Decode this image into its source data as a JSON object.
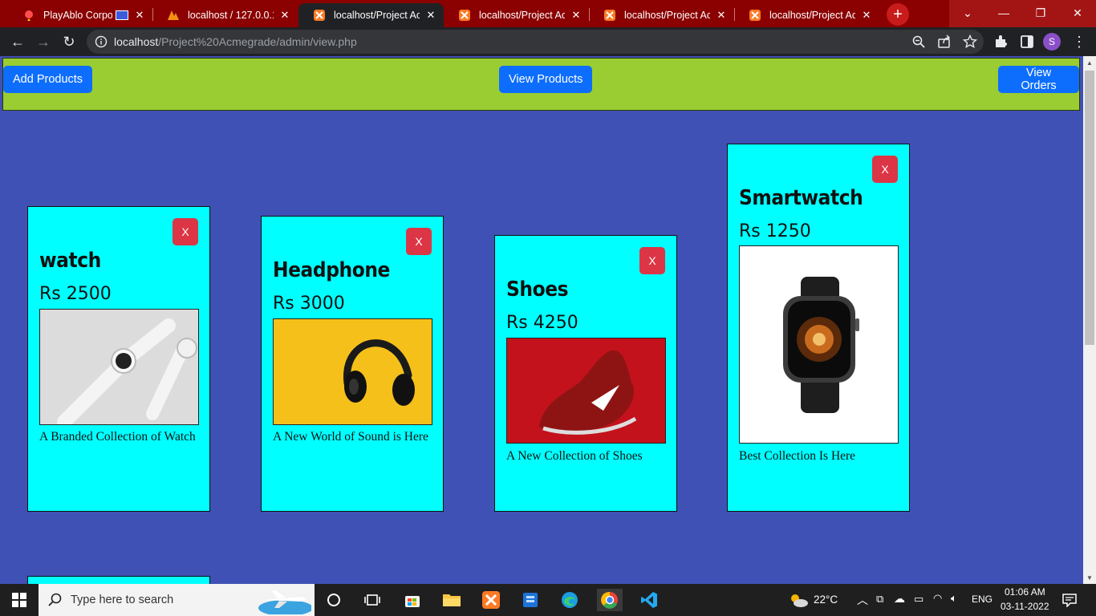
{
  "browser": {
    "tabs": [
      {
        "title": "PlayAblo Corporat",
        "icon": "playablo-icon"
      },
      {
        "title": "localhost / 127.0.0.1 /",
        "icon": "phpmyadmin-icon"
      },
      {
        "title": "localhost/Project Acm",
        "icon": "xampp-icon"
      },
      {
        "title": "localhost/Project Acm",
        "icon": "xampp-icon"
      },
      {
        "title": "localhost/Project Acm",
        "icon": "xampp-icon"
      },
      {
        "title": "localhost/Project Acm",
        "icon": "xampp-icon"
      }
    ],
    "url_host": "localhost",
    "url_path": "/Project%20Acmegrade/admin/view.php",
    "profile_initial": "S"
  },
  "nav": {
    "add_products": "Add Products",
    "view_products": "View Products",
    "view_orders": "View Orders"
  },
  "products": [
    {
      "name": "watch",
      "price": "Rs 2500",
      "desc": "A Branded Collection of Watch",
      "delete": "X"
    },
    {
      "name": "Headphone",
      "price": "Rs 3000",
      "desc": "A New World of Sound is Here",
      "delete": "X"
    },
    {
      "name": "Shoes",
      "price": "Rs 4250",
      "desc": "A New Collection of Shoes",
      "delete": "X"
    },
    {
      "name": "Smartwatch",
      "price": "Rs 1250",
      "desc": "Best Collection Is Here",
      "delete": "X"
    }
  ],
  "taskbar": {
    "search_placeholder": "Type here to search",
    "weather": "22°C",
    "language": "ENG",
    "time": "01:06 AM",
    "date": "03-11-2022"
  },
  "colors": {
    "page_bg": "#3f51b5",
    "nav_bg": "#9acd32",
    "card_bg": "#00ffff",
    "primary_button": "#0d6efd",
    "danger_button": "#dc3545",
    "tabstrip": "#8b0000"
  }
}
